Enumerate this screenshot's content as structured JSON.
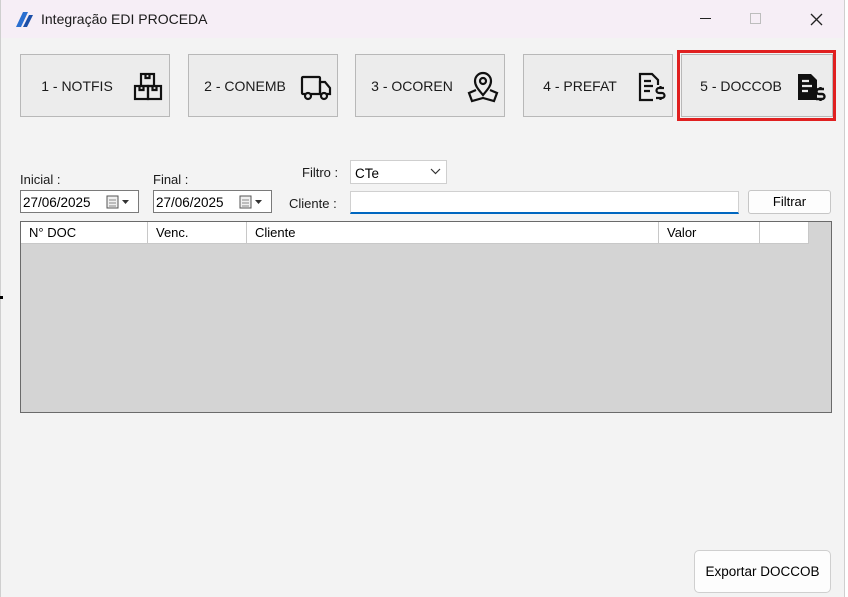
{
  "window": {
    "title": "Integração EDI PROCEDA",
    "controls": {
      "minimize": "minimize-icon",
      "maximize": "maximize-icon",
      "close": "close-icon"
    }
  },
  "modules": [
    {
      "label": "1 - NOTFIS",
      "icon": "boxes-icon",
      "selected": false
    },
    {
      "label": "2 - CONEMB",
      "icon": "truck-icon",
      "selected": false
    },
    {
      "label": "3 - OCOREN",
      "icon": "map-pin-icon",
      "selected": false
    },
    {
      "label": "4 - PREFAT",
      "icon": "invoice-icon",
      "selected": false
    },
    {
      "label": "5 - DOCCOB",
      "icon": "invoice-dollar-icon",
      "selected": true
    }
  ],
  "filters": {
    "inicial_label": "Inicial :",
    "inicial_value": "27/06/2025",
    "final_label": "Final :",
    "final_value": "27/06/2025",
    "filtro_label": "Filtro :",
    "filtro_value": "CTe",
    "cliente_label": "Cliente :",
    "cliente_value": "",
    "filter_button": "Filtrar"
  },
  "grid": {
    "columns": [
      "N° DOC",
      "Venc.",
      "Cliente",
      "Valor",
      ""
    ],
    "rows": []
  },
  "footer": {
    "export_button": "Exportar DOCCOB"
  },
  "colors": {
    "selection_border": "#e02020",
    "input_focus": "#0067c0",
    "grid_background": "#d4d4d4"
  }
}
